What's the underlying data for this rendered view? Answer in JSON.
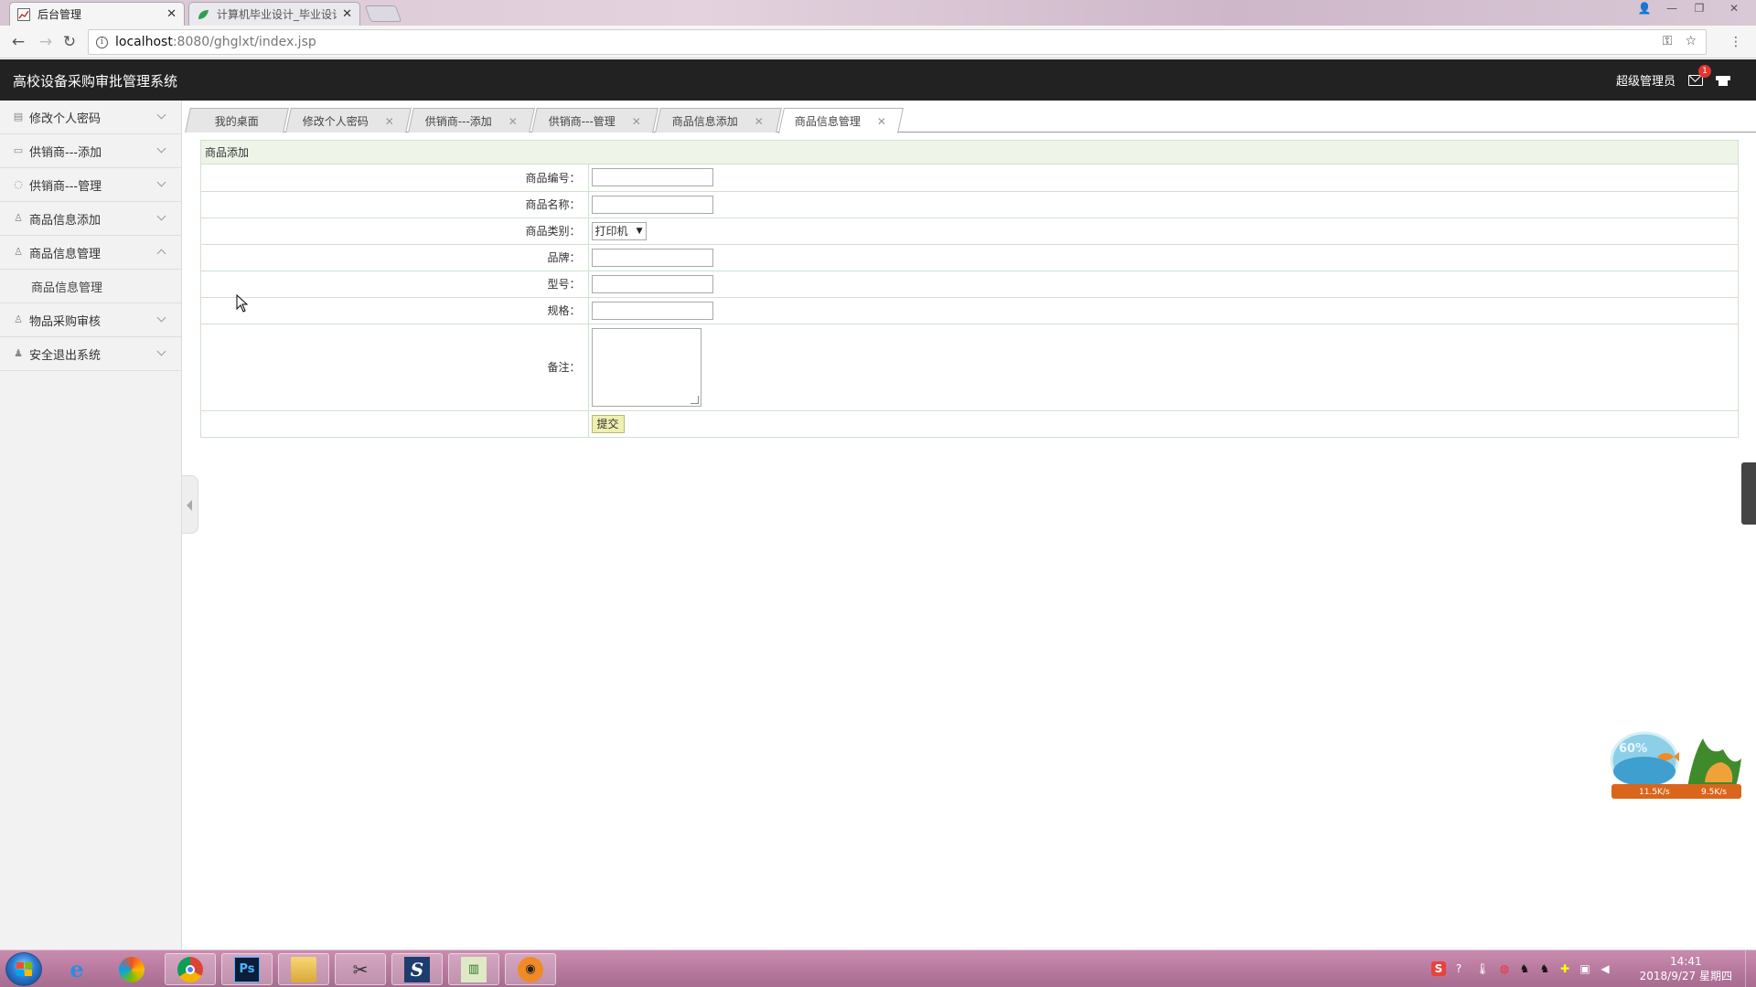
{
  "browser": {
    "tabs": [
      {
        "title": "后台管理",
        "active": true
      },
      {
        "title": "计算机毕业设计_毕业设计",
        "active": false
      }
    ],
    "url_host": "localhost",
    "url_path": ":8080/ghglxt/index.jsp"
  },
  "header": {
    "title": "高校设备采购审批管理系统",
    "user": "超级管理员",
    "mail_badge": "1"
  },
  "sidebar": {
    "items": [
      {
        "label": "修改个人密码",
        "icon": "list-icon",
        "expanded": false
      },
      {
        "label": "供销商---添加",
        "icon": "card-icon",
        "expanded": false
      },
      {
        "label": "供销商---管理",
        "icon": "chat-icon",
        "expanded": false
      },
      {
        "label": "商品信息添加",
        "icon": "user-icon",
        "expanded": false
      },
      {
        "label": "商品信息管理",
        "icon": "user-icon",
        "expanded": true,
        "sub": "商品信息管理"
      },
      {
        "label": "物品采购审核",
        "icon": "user-icon",
        "expanded": false
      },
      {
        "label": "安全退出系统",
        "icon": "user-solid-icon",
        "expanded": false
      }
    ]
  },
  "content_tabs": [
    {
      "label": "我的桌面",
      "closable": false
    },
    {
      "label": "修改个人密码",
      "closable": true
    },
    {
      "label": "供销商---添加",
      "closable": true
    },
    {
      "label": "供销商---管理",
      "closable": true
    },
    {
      "label": "商品信息添加",
      "closable": true
    },
    {
      "label": "商品信息管理",
      "closable": true,
      "active": true
    }
  ],
  "form": {
    "caption": "商品添加",
    "fields": {
      "code_label": "商品编号：",
      "name_label": "商品名称：",
      "category_label": "商品类别：",
      "category_value": "打印机",
      "brand_label": "品牌：",
      "model_label": "型号：",
      "spec_label": "规格：",
      "remark_label": "备注："
    },
    "submit_label": "提交"
  },
  "widget": {
    "percent": "60%",
    "up_speed": "11.5K/s",
    "down_speed": "9.5K/s"
  },
  "taskbar": {
    "time": "14:41",
    "date": "2018/9/27 星期四"
  }
}
